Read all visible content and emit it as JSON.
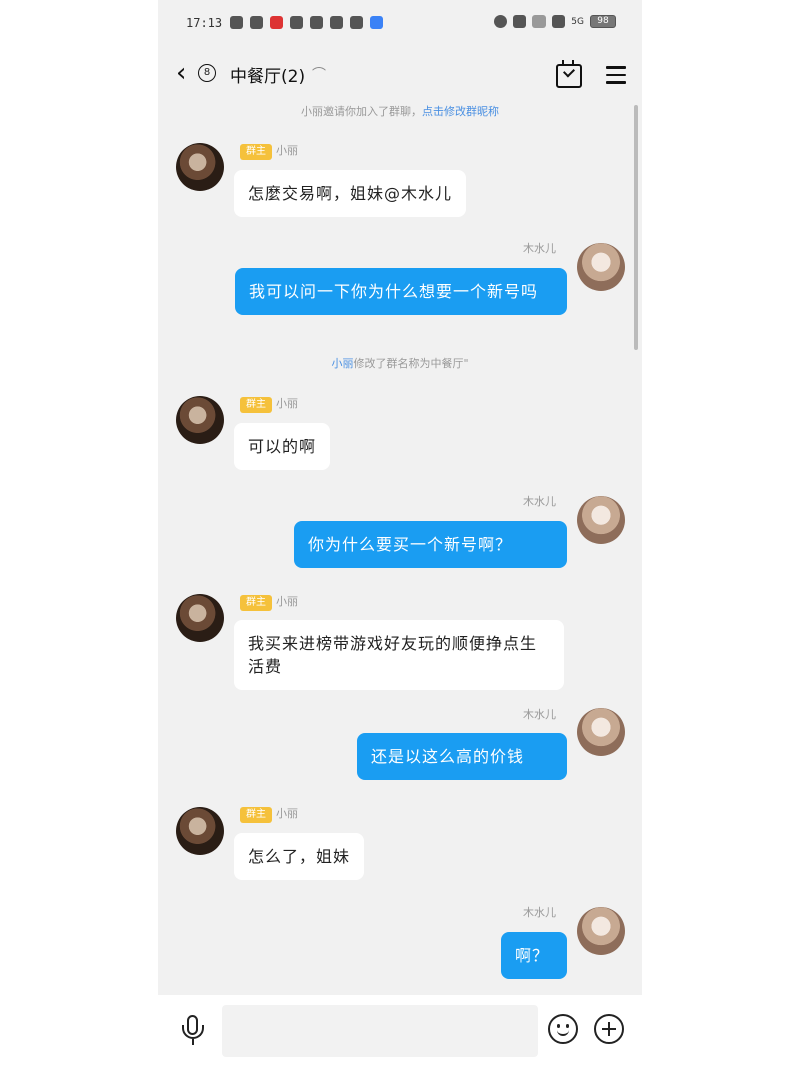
{
  "status_bar": {
    "time": "17:13",
    "network": "5G",
    "battery": "98"
  },
  "header": {
    "back_count": "8",
    "title": "中餐厅(2)"
  },
  "notices": {
    "invite_text": "小丽邀请你加入了群聊，",
    "invite_link": "点击修改群昵称",
    "rename_actor": "小丽",
    "rename_text": "修改了群名称为中餐厅\""
  },
  "owner_tag": "群主",
  "messages": [
    {
      "side": "left",
      "sender": "小丽",
      "text": "怎麼交易啊，姐妹@木水儿"
    },
    {
      "side": "right",
      "sender": "木水儿",
      "text": "我可以问一下你为什么想要一个新号吗"
    },
    {
      "side": "left",
      "sender": "小丽",
      "text": "可以的啊"
    },
    {
      "side": "right",
      "sender": "木水儿",
      "text": "你为什么要买一个新号啊？"
    },
    {
      "side": "left",
      "sender": "小丽",
      "text": "我买来进榜带游戏好友玩的顺便挣点生活费"
    },
    {
      "side": "right",
      "sender": "木水儿",
      "text": "还是以这么高的价钱"
    },
    {
      "side": "left",
      "sender": "小丽",
      "text": "怎么了，姐妹"
    },
    {
      "side": "right",
      "sender": "木水儿",
      "text": "啊？"
    }
  ],
  "input": {
    "placeholder": ""
  }
}
